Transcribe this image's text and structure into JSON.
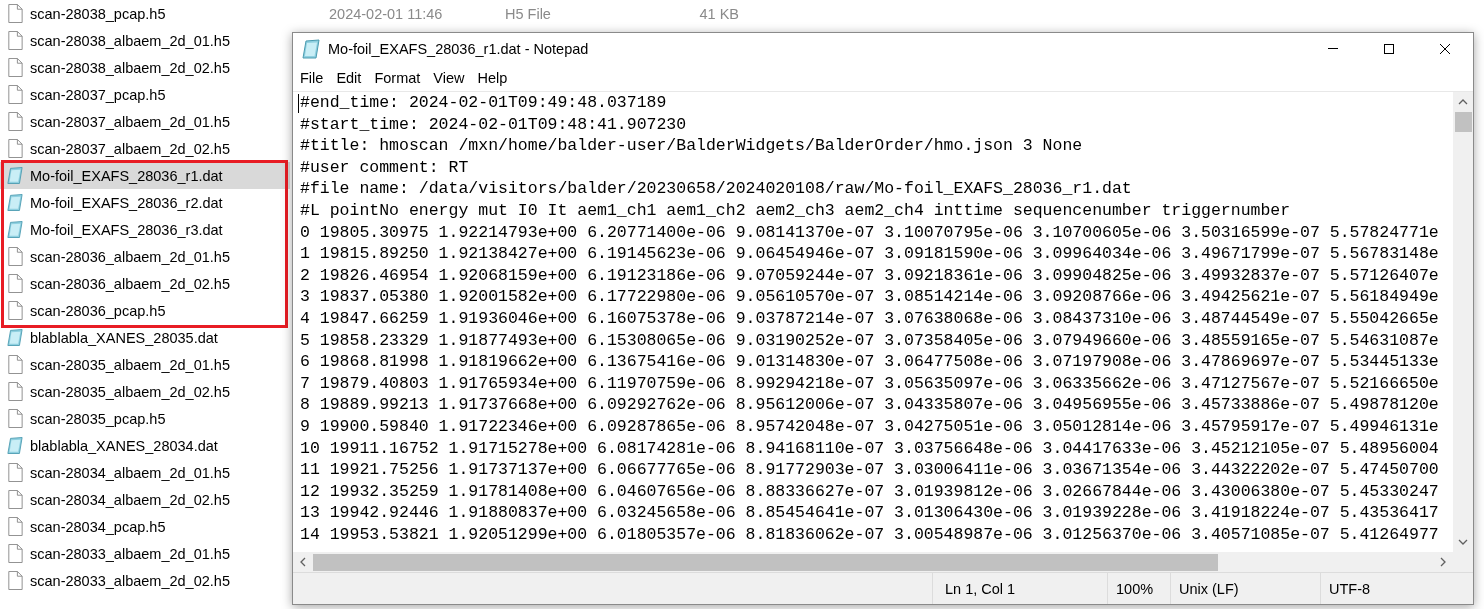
{
  "file_list": [
    {
      "name": "scan-28038_pcap.h5",
      "kind": "file",
      "selected": false,
      "date": "2024-02-01 11:46",
      "type": "H5 File",
      "size": "41 KB"
    },
    {
      "name": "scan-28038_albaem_2d_01.h5",
      "kind": "file",
      "selected": false
    },
    {
      "name": "scan-28038_albaem_2d_02.h5",
      "kind": "file",
      "selected": false
    },
    {
      "name": "scan-28037_pcap.h5",
      "kind": "file",
      "selected": false
    },
    {
      "name": "scan-28037_albaem_2d_01.h5",
      "kind": "file",
      "selected": false
    },
    {
      "name": "scan-28037_albaem_2d_02.h5",
      "kind": "file",
      "selected": false
    },
    {
      "name": "Mo-foil_EXAFS_28036_r1.dat",
      "kind": "notepad",
      "selected": true
    },
    {
      "name": "Mo-foil_EXAFS_28036_r2.dat",
      "kind": "notepad",
      "selected": false
    },
    {
      "name": "Mo-foil_EXAFS_28036_r3.dat",
      "kind": "notepad",
      "selected": false
    },
    {
      "name": "scan-28036_albaem_2d_01.h5",
      "kind": "file",
      "selected": false
    },
    {
      "name": "scan-28036_albaem_2d_02.h5",
      "kind": "file",
      "selected": false
    },
    {
      "name": "scan-28036_pcap.h5",
      "kind": "file",
      "selected": false
    },
    {
      "name": "blablabla_XANES_28035.dat",
      "kind": "notepad",
      "selected": false
    },
    {
      "name": "scan-28035_albaem_2d_01.h5",
      "kind": "file",
      "selected": false
    },
    {
      "name": "scan-28035_albaem_2d_02.h5",
      "kind": "file",
      "selected": false
    },
    {
      "name": "scan-28035_pcap.h5",
      "kind": "file",
      "selected": false
    },
    {
      "name": "blablabla_XANES_28034.dat",
      "kind": "notepad",
      "selected": false
    },
    {
      "name": "scan-28034_albaem_2d_01.h5",
      "kind": "file",
      "selected": false
    },
    {
      "name": "scan-28034_albaem_2d_02.h5",
      "kind": "file",
      "selected": false
    },
    {
      "name": "scan-28034_pcap.h5",
      "kind": "file",
      "selected": false
    },
    {
      "name": "scan-28033_albaem_2d_01.h5",
      "kind": "file",
      "selected": false
    },
    {
      "name": "scan-28033_albaem_2d_02.h5",
      "kind": "file",
      "selected": false
    }
  ],
  "notepad": {
    "title": "Mo-foil_EXAFS_28036_r1.dat - Notepad",
    "menu": [
      "File",
      "Edit",
      "Format",
      "View",
      "Help"
    ],
    "lines": [
      "#end_time: 2024-02-01T09:49:48.037189",
      "#start_time: 2024-02-01T09:48:41.907230",
      "#title: hmoscan /mxn/home/balder-user/BalderWidgets/BalderOrder/hmo.json 3 None",
      "#user comment: RT",
      "#file name: /data/visitors/balder/20230658/2024020108/raw/Mo-foil_EXAFS_28036_r1.dat",
      "#L pointNo energy mut I0 It aem1_ch1 aem1_ch2 aem2_ch3 aem2_ch4 inttime sequencenumber triggernumber",
      "0 19805.30975 1.92214793e+00 6.20771400e-06 9.08141370e-07 3.10070795e-06 3.10700605e-06 3.50316599e-07 5.57824771e",
      "1 19815.89250 1.92138427e+00 6.19145623e-06 9.06454946e-07 3.09181590e-06 3.09964034e-06 3.49671799e-07 5.56783148e",
      "2 19826.46954 1.92068159e+00 6.19123186e-06 9.07059244e-07 3.09218361e-06 3.09904825e-06 3.49932837e-07 5.57126407e",
      "3 19837.05380 1.92001582e+00 6.17722980e-06 9.05610570e-07 3.08514214e-06 3.09208766e-06 3.49425621e-07 5.56184949e",
      "4 19847.66259 1.91936046e+00 6.16075378e-06 9.03787214e-07 3.07638068e-06 3.08437310e-06 3.48744549e-07 5.55042665e",
      "5 19858.23329 1.91877493e+00 6.15308065e-06 9.03190252e-07 3.07358405e-06 3.07949660e-06 3.48559165e-07 5.54631087e",
      "6 19868.81998 1.91819662e+00 6.13675416e-06 9.01314830e-07 3.06477508e-06 3.07197908e-06 3.47869697e-07 5.53445133e",
      "7 19879.40803 1.91765934e+00 6.11970759e-06 8.99294218e-07 3.05635097e-06 3.06335662e-06 3.47127567e-07 5.52166650e",
      "8 19889.99213 1.91737668e+00 6.09292762e-06 8.95612006e-07 3.04335807e-06 3.04956955e-06 3.45733886e-07 5.49878120e",
      "9 19900.59840 1.91722346e+00 6.09287865e-06 8.95742048e-07 3.04275051e-06 3.05012814e-06 3.45795917e-07 5.49946131e",
      "10 19911.16752 1.91715278e+00 6.08174281e-06 8.94168110e-07 3.03756648e-06 3.04417633e-06 3.45212105e-07 5.48956004",
      "11 19921.75256 1.91737137e+00 6.06677765e-06 8.91772903e-07 3.03006411e-06 3.03671354e-06 3.44322202e-07 5.47450700",
      "12 19932.35259 1.91781408e+00 6.04607656e-06 8.88336627e-07 3.01939812e-06 3.02667844e-06 3.43006380e-07 5.45330247",
      "13 19942.92446 1.91880837e+00 6.03245658e-06 8.85454641e-07 3.01306430e-06 3.01939228e-06 3.41918224e-07 5.43536417",
      "14 19953.53821 1.92051299e+00 6.01805357e-06 8.81836062e-07 3.00548987e-06 3.01256370e-06 3.40571085e-07 5.41264977"
    ],
    "status": {
      "position": "Ln 1, Col 1",
      "zoom": "100%",
      "line_endings": "Unix (LF)",
      "encoding": "UTF-8"
    }
  }
}
